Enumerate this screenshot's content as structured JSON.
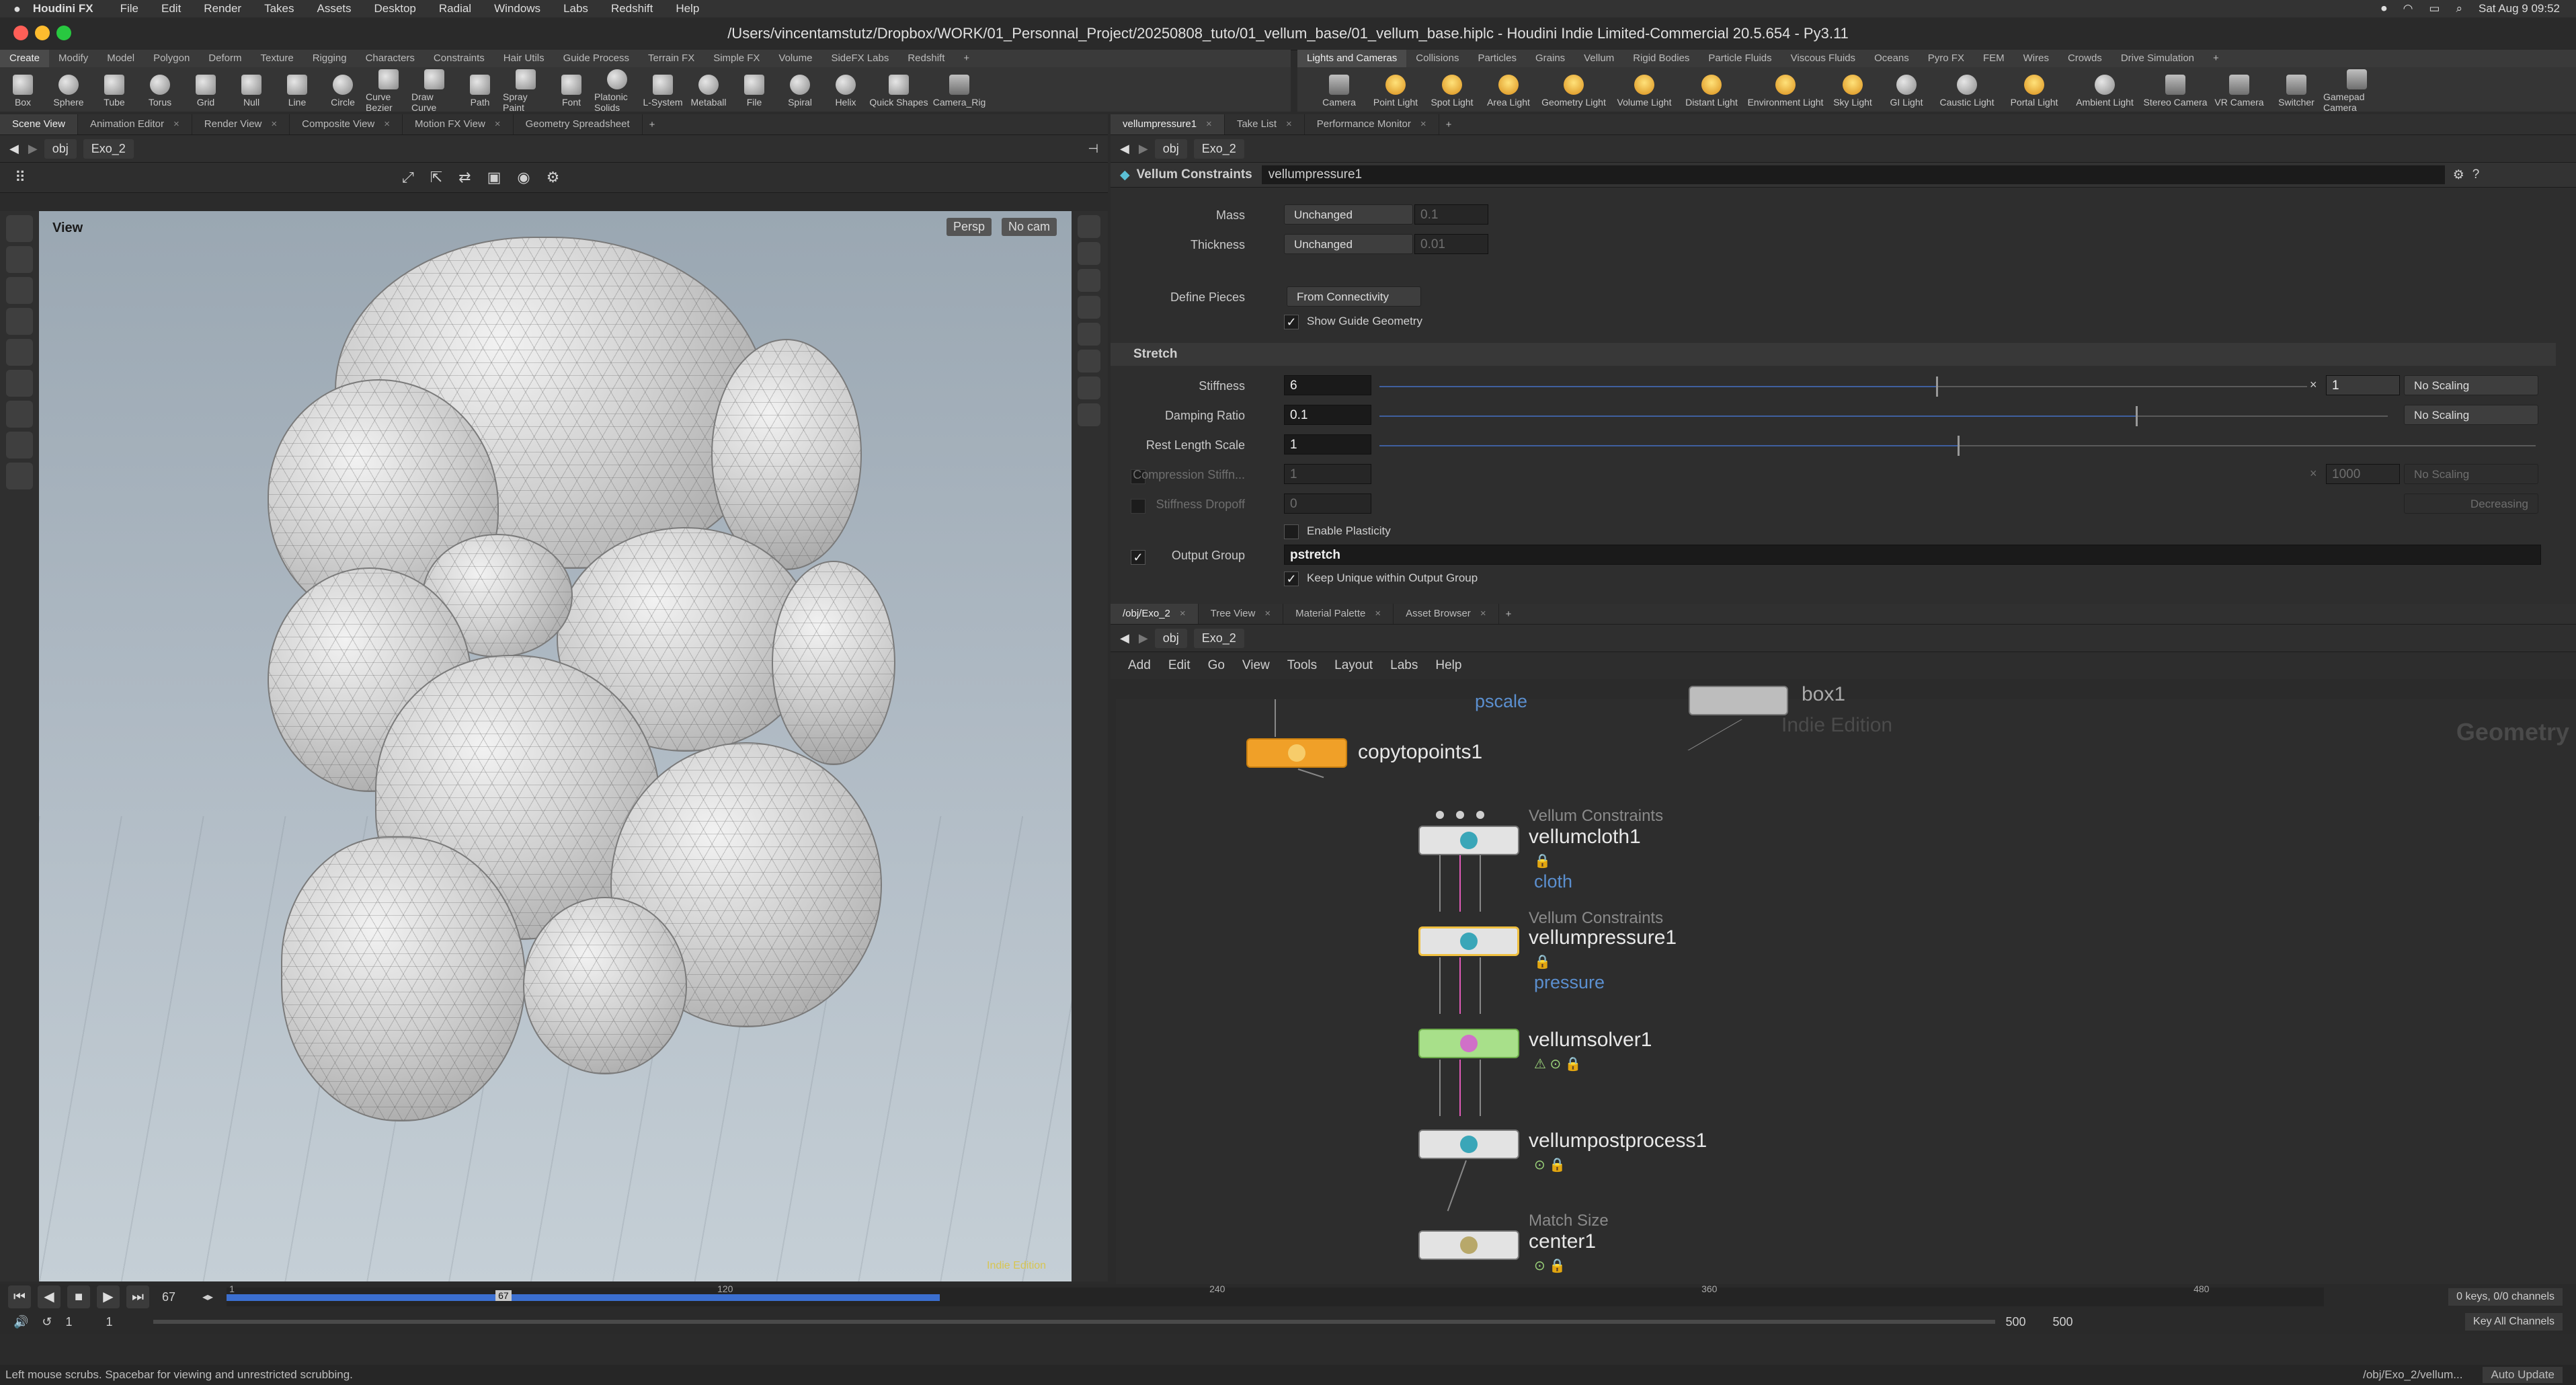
{
  "macmenu": {
    "app": "Houdini FX",
    "items": [
      "File",
      "Edit",
      "Render",
      "Takes",
      "Assets",
      "Desktop",
      "Radial",
      "Windows",
      "Labs",
      "Redshift",
      "Help"
    ],
    "clock": "Sat Aug 9  09:52"
  },
  "window": {
    "title": "/Users/vincentamstutz/Dropbox/WORK/01_Personnal_Project/20250808_tuto/01_vellum_base/01_vellum_base.hiplc - Houdini Indie Limited-Commercial 20.5.654 - Py3.11"
  },
  "shelf_left": {
    "tabs": [
      "Create",
      "Modify",
      "Model",
      "Polygon",
      "Deform",
      "Texture",
      "Rigging",
      "Characters",
      "Constraints",
      "Hair Utils",
      "Guide Process",
      "Terrain FX",
      "Simple FX",
      "Volume",
      "SideFX Labs",
      "Redshift"
    ],
    "tools": [
      "Box",
      "Sphere",
      "Tube",
      "Torus",
      "Grid",
      "Null",
      "Line",
      "Circle",
      "Curve Bezier",
      "Draw Curve",
      "Path",
      "Spray Paint",
      "Font",
      "Platonic Solids",
      "L-System",
      "Metaball",
      "File",
      "Spiral",
      "Helix",
      "Quick Shapes",
      "Camera_Rig"
    ]
  },
  "shelf_right": {
    "tabs": [
      "Lights and Cameras",
      "Collisions",
      "Particles",
      "Grains",
      "Vellum",
      "Rigid Bodies",
      "Particle Fluids",
      "Viscous Fluids",
      "Oceans",
      "Pyro FX",
      "FEM",
      "Wires",
      "Crowds",
      "Drive Simulation"
    ],
    "tools": [
      "Camera",
      "Point Light",
      "Spot Light",
      "Area Light",
      "Geometry Light",
      "Volume Light",
      "Distant Light",
      "Environment Light",
      "Sky Light",
      "GI Light",
      "Caustic Light",
      "Portal Light",
      "Ambient Light",
      "Stereo Camera",
      "VR Camera",
      "Switcher",
      "Gamepad Camera"
    ]
  },
  "left_pane": {
    "tabs": [
      "Scene View",
      "Animation Editor",
      "Render View",
      "Composite View",
      "Motion FX View",
      "Geometry Spreadsheet"
    ],
    "path_root": "obj",
    "path_node": "Exo_2",
    "viewport_label": "View",
    "persp_button": "Persp",
    "cam_button": "No cam",
    "watermark": "Indie Edition"
  },
  "right_top_pane": {
    "tabs": [
      "vellumpressure1",
      "Take List",
      "Performance Monitor"
    ],
    "path_root": "obj",
    "path_node": "Exo_2",
    "node_type": "Vellum Constraints",
    "node_name": "vellumpressure1",
    "params": {
      "mass_label": "Mass",
      "mass_value": "Unchanged",
      "mass_num": "0.1",
      "thickness_label": "Thickness",
      "thickness_value": "Unchanged",
      "thickness_num": "0.01",
      "define_pieces_label": "Define Pieces",
      "define_pieces_value": "From Connectivity",
      "show_guide_label": "Show Guide Geometry",
      "stretch_header": "Stretch",
      "stiffness_label": "Stiffness",
      "stiffness_value": "6",
      "stiffness_mult": "1",
      "stiffness_scaling": "No Scaling",
      "stiffness_slider": 0.6,
      "damping_label": "Damping Ratio",
      "damping_value": "0.1",
      "damping_scaling": "No Scaling",
      "damping_slider": 0.75,
      "rest_label": "Rest Length Scale",
      "rest_value": "1",
      "rest_slider": 0.5,
      "compression_label": "Compression Stiffn...",
      "compression_value": "1",
      "compression_mult": "1000",
      "compression_scaling": "No Scaling",
      "dropoff_label": "Stiffness Dropoff",
      "dropoff_value": "0",
      "dropoff_mode": "Decreasing",
      "plasticity_label": "Enable Plasticity",
      "output_group_label": "Output Group",
      "output_group_value": "pstretch",
      "keep_unique_label": "Keep Unique within Output Group"
    }
  },
  "right_bottom_pane": {
    "tabs": [
      "/obj/Exo_2",
      "Tree View",
      "Material Palette",
      "Asset Browser"
    ],
    "path_root": "obj",
    "path_node": "Exo_2",
    "menu": [
      "Add",
      "Edit",
      "Go",
      "View",
      "Tools",
      "Layout",
      "Labs",
      "Help"
    ],
    "context_label": "Geometry",
    "watermark": "Indie Edition",
    "nodes": [
      {
        "id": "pscale",
        "name": "",
        "sub": "pscale"
      },
      {
        "id": "box1",
        "name": "box1"
      },
      {
        "id": "copytopoints1",
        "name": "copytopoints1"
      },
      {
        "id": "vellumcloth1",
        "name": "vellumcloth1",
        "type": "Vellum Constraints",
        "sub": "cloth"
      },
      {
        "id": "vellumpressure1",
        "name": "vellumpressure1",
        "type": "Vellum Constraints",
        "sub": "pressure"
      },
      {
        "id": "vellumsolver1",
        "name": "vellumsolver1"
      },
      {
        "id": "vellumpostprocess1",
        "name": "vellumpostprocess1"
      },
      {
        "id": "center1",
        "name": "center1",
        "type": "Match Size"
      }
    ]
  },
  "timeline": {
    "current_frame": "67",
    "ticks": [
      "1",
      "120",
      "240",
      "360",
      "480"
    ],
    "start": "1",
    "start2": "1",
    "end": "500",
    "end2": "500",
    "keys_info": "0 keys, 0/0 channels",
    "key_all": "Key All Channels",
    "playback_progress": 0.34
  },
  "status": {
    "message": "Left mouse scrubs. Spacebar for viewing and unrestricted scrubbing.",
    "path": "/obj/Exo_2/vellum...",
    "update": "Auto Update"
  }
}
